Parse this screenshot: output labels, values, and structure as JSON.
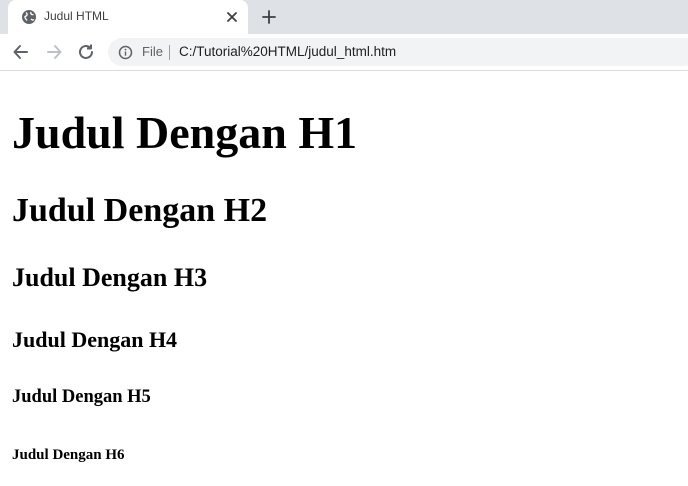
{
  "browser": {
    "tab": {
      "title": "Judul HTML"
    },
    "address_bar": {
      "security_chip": "File",
      "url": "C:/Tutorial%20HTML/judul_html.htm"
    },
    "icons": {
      "favicon": "globe-icon",
      "close": "close-icon",
      "new_tab": "plus-icon",
      "back": "arrow-left-icon",
      "forward": "arrow-right-icon",
      "reload": "reload-icon",
      "info": "info-icon"
    }
  },
  "page": {
    "headings": {
      "h1": "Judul Dengan H1",
      "h2": "Judul Dengan H2",
      "h3": "Judul Dengan H3",
      "h4": "Judul Dengan H4",
      "h5": "Judul Dengan H5",
      "h6": "Judul Dengan H6"
    }
  }
}
